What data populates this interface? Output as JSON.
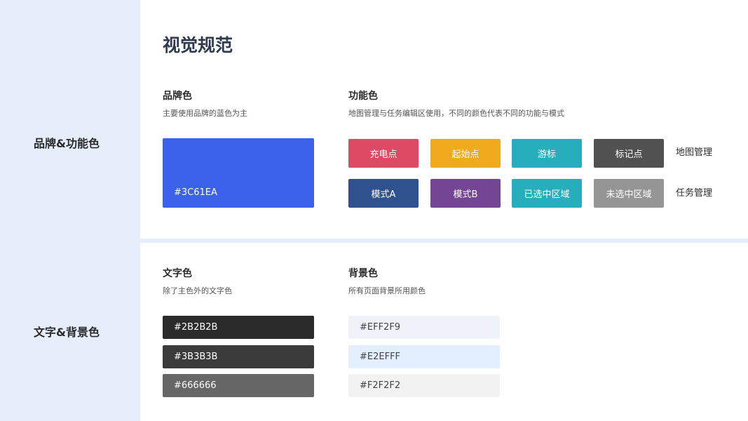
{
  "sidebar": {
    "brand_function_label": "品牌&功能色",
    "text_bg_label": "文字&背景色"
  },
  "page_title": "视觉规范",
  "brand": {
    "title": "品牌色",
    "desc": "主要使用品牌的蓝色为主",
    "color": "#3C61EA",
    "hex_label": "#3C61EA"
  },
  "function": {
    "title": "功能色",
    "desc": "地图管理与任务编辑区使用，不同的颜色代表不同的功能与模式",
    "rows": [
      {
        "label": "地图管理",
        "chips": [
          {
            "label": "充电点",
            "color": "#DE4A63"
          },
          {
            "label": "起始点",
            "color": "#EFAA1E"
          },
          {
            "label": "游标",
            "color": "#26AEBD"
          },
          {
            "label": "标记点",
            "color": "#515151"
          }
        ]
      },
      {
        "label": "任务管理",
        "chips": [
          {
            "label": "模式A",
            "color": "#2F528E"
          },
          {
            "label": "模式B",
            "color": "#744592"
          },
          {
            "label": "已选中区域",
            "color": "#26AEBD"
          },
          {
            "label": "未选中区域",
            "color": "#959595"
          }
        ]
      }
    ]
  },
  "text_colors": {
    "title": "文字色",
    "desc": "除了主色外的文字色",
    "swatches": [
      {
        "label": "#2B2B2B",
        "color": "#2B2B2B"
      },
      {
        "label": "#3B3B3B",
        "color": "#3B3B3B"
      },
      {
        "label": "#666666",
        "color": "#666666"
      }
    ]
  },
  "bg_colors": {
    "title": "背景色",
    "desc": "所有页面背景所用颜色",
    "swatches": [
      {
        "label": "#EFF2F9",
        "color": "#EFF2F9"
      },
      {
        "label": "#E2EFFF",
        "color": "#E2EFFF"
      },
      {
        "label": "#F2F2F2",
        "color": "#F2F2F2"
      }
    ]
  }
}
